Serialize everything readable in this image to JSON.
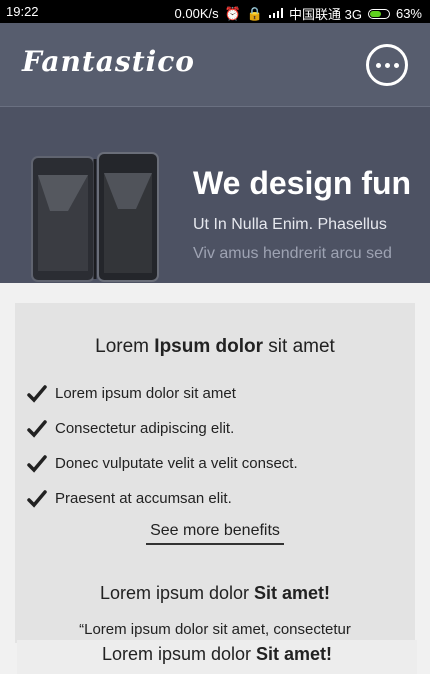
{
  "status_bar": {
    "time": "19:22",
    "net_speed": "0.00K/s",
    "carrier": "中国联通 3G",
    "battery": "63%",
    "battery_level": 0.63,
    "battery_color": "#5fd21f"
  },
  "header": {
    "logo": "Fantastico",
    "menu_icon": "more-horizontal-icon"
  },
  "hero": {
    "title": "We design fun",
    "subtitle": "Ut In Nulla Enim. Phasellus",
    "subtitle2": "Viv amus hendrerit arcu sed"
  },
  "benefits": {
    "title_pre": "Lorem ",
    "title_bold": "Ipsum dolor",
    "title_post": " sit amet",
    "items": [
      "Lorem ipsum dolor sit amet",
      "Consectetur adipiscing elit.",
      "Donec vulputate velit a velit consect.",
      "Praesent at accumsan elit."
    ],
    "see_more": "See more benefits"
  },
  "testimonial": {
    "title_pre": "Lorem ipsum dolor ",
    "title_bold": "Sit amet!",
    "quote": "“Lorem ipsum dolor sit amet, consectetur"
  },
  "footer_title": {
    "pre": "Lorem ipsum dolor ",
    "bold": "Sit amet!"
  },
  "colors": {
    "header": "#575d6e",
    "hero": "#4d5263",
    "card": "#e3e3e3"
  }
}
